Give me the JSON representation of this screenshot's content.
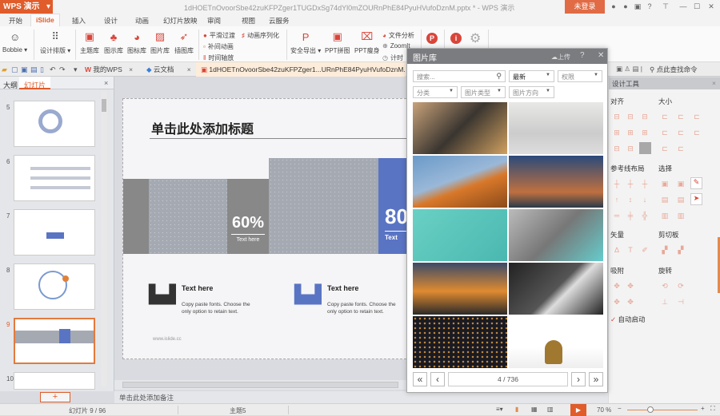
{
  "titlebar": {
    "app": "WPS 演示",
    "doc_title": "1dHOETnOvoorSbe42zuKFPZger1TUGDxSg74dYl0mZOURnPhE84PyuHVufoDznM.pptx * - WPS 演示",
    "login": "未登录"
  },
  "menu": {
    "tabs": [
      "开始",
      "iSlide",
      "插入",
      "设计",
      "动画",
      "幻灯片放映",
      "审阅",
      "视图",
      "云服务"
    ],
    "active": "iSlide"
  },
  "ribbon": {
    "user": "Bobbie",
    "design_layout": "设计排版",
    "theme_lib": "主题库",
    "diagram_lib": "图示库",
    "icon_lib": "图标库",
    "image_lib": "图片库",
    "illustration_lib": "插图库",
    "smooth": "平滑过渡",
    "tween": "补间动画",
    "timeline": "时间轴放",
    "anim_seq": "动画序列化",
    "export": "安全导出",
    "ppt_collage": "PPT拼图",
    "ppt_slim": "PPT瘦身",
    "file_analysis": "文件分析",
    "zoomit": "ZoomIt",
    "timer": "计时"
  },
  "tabbar": {
    "my_wps": "我的WPS",
    "cloud_docs": "云文档",
    "active_doc": "1dHOETnOvoorSbe42zuKFPZger1...URnPhE84PyuHVufoDznM.pptx",
    "search_cmd": "点此查找命令"
  },
  "left_panel": {
    "tab_outline": "大纲",
    "tab_slides": "幻灯片",
    "slides": [
      "5",
      "6",
      "7",
      "8",
      "9",
      "10"
    ],
    "selected": "9"
  },
  "slide": {
    "title": "单击此处添加标题",
    "pct1": "60%",
    "sub1": "Text here",
    "pct2": "80",
    "sub2": "Text",
    "item1_title": "Text here",
    "item1_body": "Copy paste fonts. Choose the only option to retain text.",
    "item2_title": "Text here",
    "item2_body": "Copy paste fonts. Choose the only option to retain text.",
    "footer": "www.islide.cc"
  },
  "notes": "单击此处添加备注",
  "dialog": {
    "title": "图片库",
    "upload": "上传",
    "help": "?",
    "search_placeholder": "搜索...",
    "sort": "最新",
    "license": "权限",
    "category": "分类",
    "image_type": "图片类型",
    "orientation": "图片方向",
    "page": "4 / 736"
  },
  "design_panel": {
    "title": "设计工具",
    "align": "对齐",
    "size": "大小",
    "guides": "参考线布局",
    "select": "选择",
    "vector": "矢量",
    "clipboard": "剪切板",
    "snap": "吸附",
    "rotate": "旋转",
    "auto_start": "自动启动"
  },
  "status": {
    "slide_count": "幻灯片 9 / 96",
    "theme": "主题5",
    "zoom": "70 %",
    "zoom_fraction": 0.33
  },
  "colors": {
    "brand": "#e05c2a",
    "accent_blue": "#5a74c4"
  }
}
